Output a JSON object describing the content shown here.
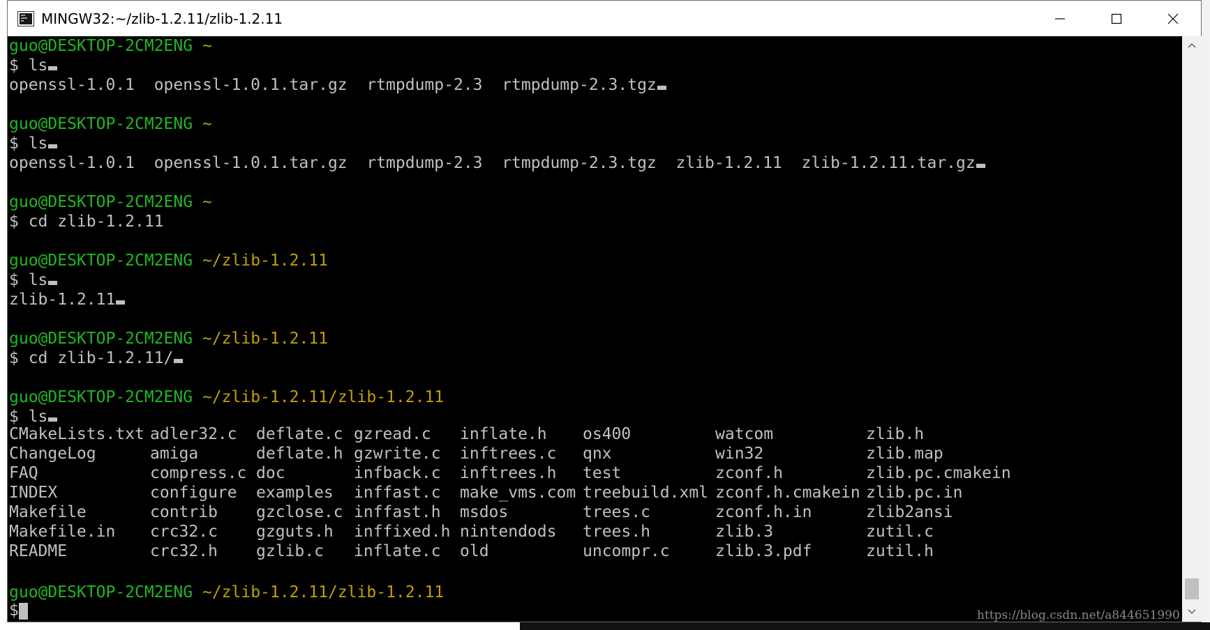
{
  "window": {
    "title": "MINGW32:~/zlib-1.2.11/zlib-1.2.11",
    "controls": {
      "minimize": "minimize-icon",
      "maximize": "maximize-icon",
      "close": "close-icon"
    }
  },
  "colors": {
    "prompt_user": "#1fb81f",
    "prompt_path": "#c0a000",
    "text": "#c0c0c0",
    "background": "#000000"
  },
  "terminal": {
    "lines": [
      {
        "user": "guo@DESKTOP-2CM2ENG",
        "path": "~"
      },
      {
        "text": "$ ls",
        "cursor": true
      },
      {
        "text": "openssl-1.0.1  openssl-1.0.1.tar.gz  rtmpdump-2.3  rtmpdump-2.3.tgz",
        "cursor": true
      },
      {
        "text": ""
      },
      {
        "user": "guo@DESKTOP-2CM2ENG",
        "path": "~"
      },
      {
        "text": "$ ls",
        "cursor": true
      },
      {
        "text": "openssl-1.0.1  openssl-1.0.1.tar.gz  rtmpdump-2.3  rtmpdump-2.3.tgz  zlib-1.2.11  zlib-1.2.11.tar.gz",
        "cursor": true
      },
      {
        "text": ""
      },
      {
        "user": "guo@DESKTOP-2CM2ENG",
        "path": "~"
      },
      {
        "text": "$ cd zlib-1.2.11"
      },
      {
        "text": ""
      },
      {
        "user": "guo@DESKTOP-2CM2ENG",
        "path": "~/zlib-1.2.11"
      },
      {
        "text": "$ ls",
        "cursor": true
      },
      {
        "text": "zlib-1.2.11",
        "cursor": true
      },
      {
        "text": ""
      },
      {
        "user": "guo@DESKTOP-2CM2ENG",
        "path": "~/zlib-1.2.11"
      },
      {
        "text": "$ cd zlib-1.2.11/",
        "cursor": true
      },
      {
        "text": ""
      },
      {
        "user": "guo@DESKTOP-2CM2ENG",
        "path": "~/zlib-1.2.11/zlib-1.2.11"
      },
      {
        "text": "$ ls",
        "cursor": true
      }
    ],
    "ls_columns": [
      [
        "CMakeLists.txt",
        "ChangeLog",
        "FAQ",
        "INDEX",
        "Makefile",
        "Makefile.in",
        "README"
      ],
      [
        "adler32.c",
        "amiga",
        "compress.c",
        "configure",
        "contrib",
        "crc32.c",
        "crc32.h"
      ],
      [
        "deflate.c",
        "deflate.h",
        "doc",
        "examples",
        "gzclose.c",
        "gzguts.h",
        "gzlib.c"
      ],
      [
        "gzread.c",
        "gzwrite.c",
        "infback.c",
        "inffast.c",
        "inffast.h",
        "inffixed.h",
        "inflate.c"
      ],
      [
        "inflate.h",
        "inftrees.c",
        "inftrees.h",
        "make_vms.com",
        "msdos",
        "nintendods",
        "old"
      ],
      [
        "os400",
        "qnx",
        "test",
        "treebuild.xml",
        "trees.c",
        "trees.h",
        "uncompr.c"
      ],
      [
        "watcom",
        "win32",
        "zconf.h",
        "zconf.h.cmakein",
        "zconf.h.in",
        "zlib.3",
        "zlib.3.pdf"
      ],
      [
        "zlib.h",
        "zlib.map",
        "zlib.pc.cmakein",
        "zlib.pc.in",
        "zlib2ansi",
        "zutil.c",
        "zutil.h"
      ]
    ],
    "final_prompt": {
      "user": "guo@DESKTOP-2CM2ENG",
      "path": "~/zlib-1.2.11/zlib-1.2.11"
    },
    "final_line": "$"
  },
  "scrollbar": {
    "up": "chevron-up-icon",
    "down": "chevron-down-icon"
  },
  "watermark": "https://blog.csdn.net/a844651990"
}
